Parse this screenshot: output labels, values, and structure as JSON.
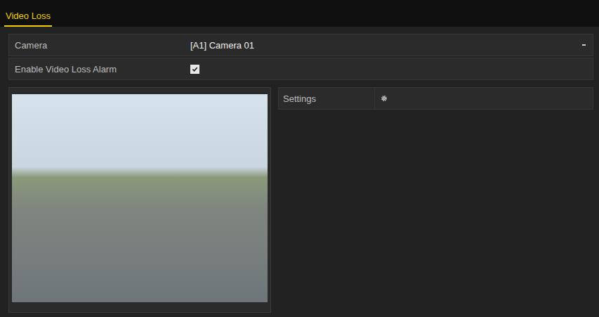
{
  "tabs": [
    {
      "label": "Video Loss",
      "selected": true
    }
  ],
  "fields": [
    {
      "kind": "dropdown",
      "label": "Camera",
      "value": "[A1] Camera 01"
    },
    {
      "kind": "checkbox",
      "label": "Enable Video Loss Alarm",
      "checked": true
    }
  ],
  "settings": {
    "label": "Settings"
  }
}
